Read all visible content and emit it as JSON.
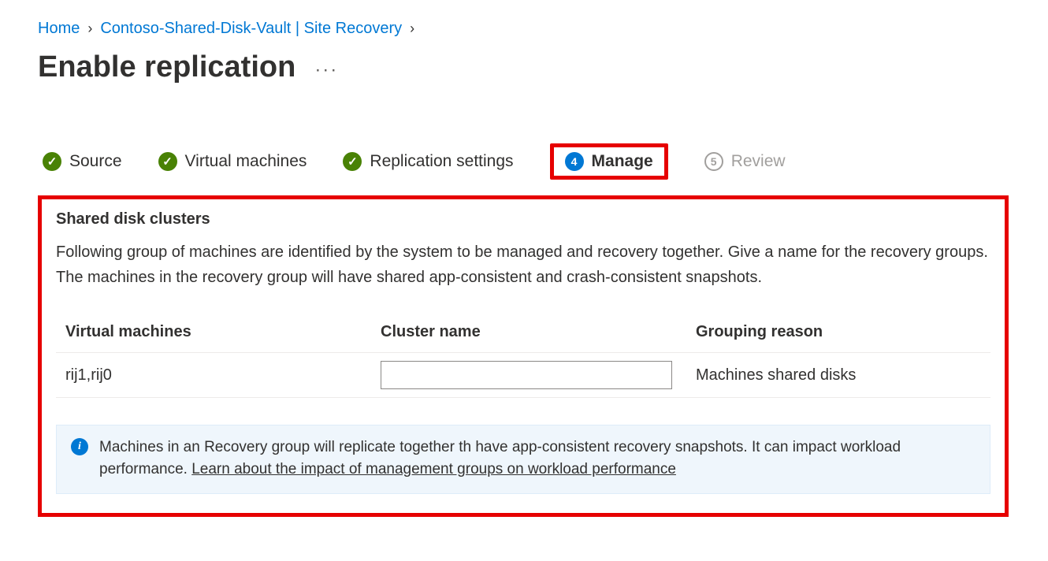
{
  "breadcrumb": {
    "home": "Home",
    "vault": "Contoso-Shared-Disk-Vault | Site Recovery"
  },
  "page_title": "Enable replication",
  "tabs": {
    "source": "Source",
    "vms": "Virtual machines",
    "repl": "Replication settings",
    "manage": "Manage",
    "manage_step": "4",
    "review": "Review",
    "review_step": "5"
  },
  "section": {
    "title": "Shared disk clusters",
    "desc": "Following group of machines are identified by the system to be managed and recovery together. Give a name for the recovery groups. The machines in the recovery group will have shared app-consistent and crash-consistent snapshots."
  },
  "table": {
    "headers": {
      "vm": "Virtual machines",
      "name": "Cluster name",
      "reason": "Grouping reason"
    },
    "rows": [
      {
        "vm": "rij1,rij0",
        "name": "",
        "reason": "Machines shared disks"
      }
    ]
  },
  "info": {
    "text": "Machines in an Recovery group will replicate together th have app-consistent recovery snapshots. It can impact workload performance. ",
    "link": "Learn about the impact of management groups on workload performance"
  }
}
